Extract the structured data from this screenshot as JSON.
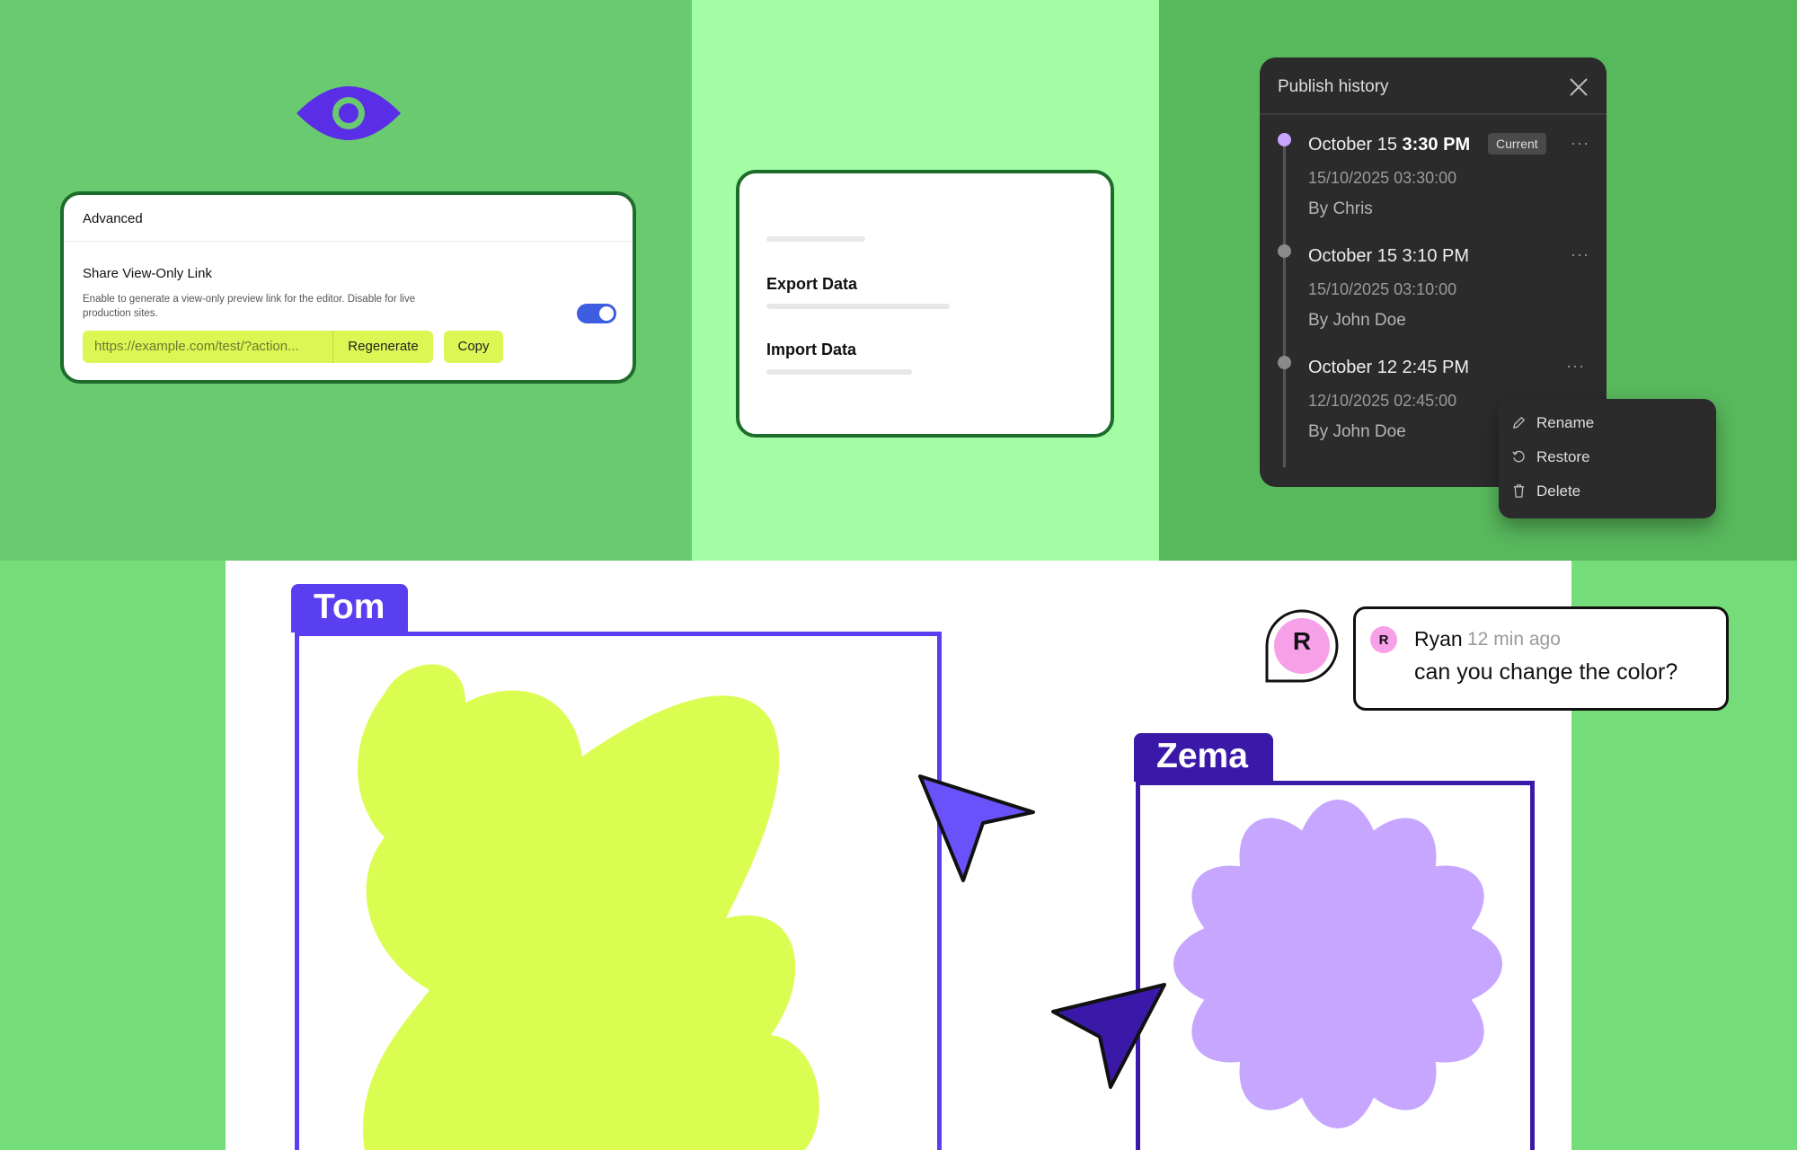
{
  "colors": {
    "bg_left": "#6aca6f",
    "bg_mid": "#a2fda4",
    "bg_right": "#58b85c",
    "bg_bottom": "#75dc7a",
    "accent_lime": "#dcf654",
    "card_border": "#1e6c2c",
    "toggle_on": "#3f5de0",
    "tom_color": "#5a3ff0",
    "zema_color": "#3a19a8",
    "blob_fill": "#dbfd52",
    "flower_fill": "#c7a6ff",
    "avatar_pink": "#f6a0e8",
    "history_bg": "#2b2b2b"
  },
  "icons": {
    "eye": "eye-icon",
    "close": "close-icon",
    "more": "more-horizontal-icon",
    "rename": "pencil-icon",
    "restore": "restore-icon",
    "delete": "trash-icon"
  },
  "advanced": {
    "header": "Advanced",
    "title": "Share View-Only Link",
    "description": "Enable to generate a view-only preview link for the editor. Disable for live production sites.",
    "toggle_on": true,
    "url_value": "https://example.com/test/?action...",
    "regenerate_label": "Regenerate",
    "copy_label": "Copy"
  },
  "data_menu": {
    "export_label": "Export Data",
    "import_label": "Import Data"
  },
  "history": {
    "title": "Publish history",
    "entries": [
      {
        "date": "October 15 ",
        "time": "3:30 PM",
        "badge": "Current",
        "timestamp": "15/10/2025 03:30:00",
        "by": "By Chris"
      },
      {
        "date": "October 15 ",
        "time": "3:10 PM",
        "timestamp": "15/10/2025 03:10:00",
        "by": "By John Doe"
      },
      {
        "date": "October 12 ",
        "time": "2:45 PM",
        "timestamp": "12/10/2025 02:45:00",
        "by": "By John Doe"
      }
    ],
    "more_label": "···"
  },
  "context_menu": {
    "items": [
      {
        "label": "Rename"
      },
      {
        "label": "Restore"
      },
      {
        "label": "Delete"
      }
    ]
  },
  "board": {
    "frame_tom": "Tom",
    "frame_zema": "Zema"
  },
  "comment": {
    "avatar_letter": "R",
    "author": "Ryan",
    "time": "12 min ago",
    "text": "can you change the color?"
  }
}
